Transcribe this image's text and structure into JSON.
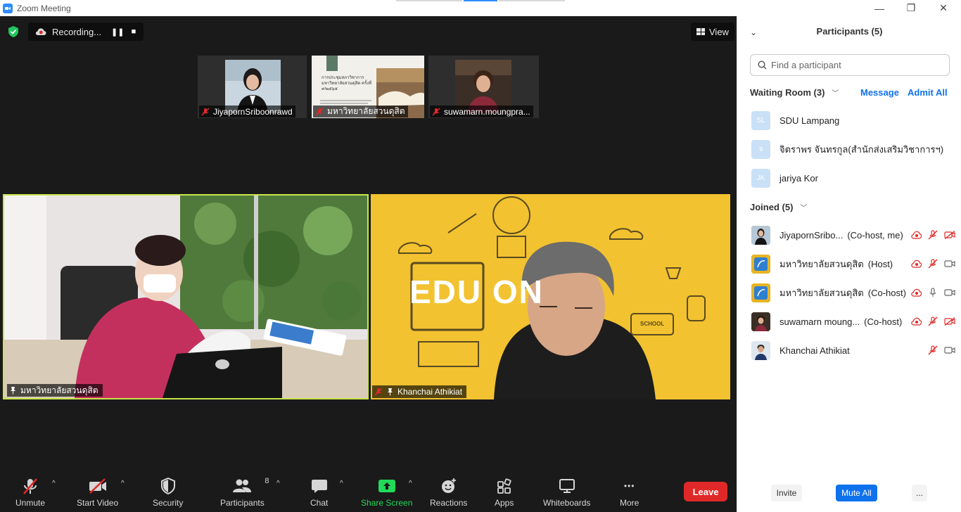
{
  "window": {
    "title": "Zoom Meeting",
    "minimize": "—",
    "restore": "❐",
    "close": "✕"
  },
  "topbar": {
    "recording_label": "Recording...",
    "pause_symbol": "❚❚",
    "stop_symbol": "■",
    "view_label": "View"
  },
  "thumbnails": [
    {
      "name": "JiyapornSriboonrawd"
    },
    {
      "name": "มหาวิทยาลัยสวนดุสิต",
      "slide_text": "การประชุมสภาวิชาการ มหาวิทยาลัยสวนดุสิต ครั้งที่ ๙/๒๕๖๕"
    },
    {
      "name": "suwamarn.moungpra..."
    }
  ],
  "tiles": [
    {
      "name": "มหาวิทยาลัยสวนดุสิต"
    },
    {
      "name": "Khanchai Athikiat",
      "background_text": "EDU ON",
      "school_text": "SCHOOL"
    }
  ],
  "toolbar": {
    "unmute": "Unmute",
    "start_video": "Start Video",
    "security": "Security",
    "participants": "Participants",
    "participants_count": "8",
    "chat": "Chat",
    "share_screen": "Share Screen",
    "reactions": "Reactions",
    "apps": "Apps",
    "whiteboards": "Whiteboards",
    "more": "More",
    "leave": "Leave",
    "more_dots": "•••",
    "caret": "^"
  },
  "panel": {
    "title": "Participants (5)",
    "collapse_symbol": "⌄",
    "search_placeholder": "Find a participant",
    "waiting_room": {
      "label": "Waiting Room (3)",
      "message": "Message",
      "admit_all": "Admit All",
      "people": [
        {
          "initials": "SL",
          "name": "SDU Lampang"
        },
        {
          "initials": "จ",
          "name": "จิตราพร จันทรกูล(สำนักส่งเสริมวิชาการฯ)"
        },
        {
          "initials": "JK",
          "name": "jariya Kor"
        }
      ]
    },
    "joined": {
      "label": "Joined (5)",
      "people": [
        {
          "name": "JiyapornSribo...",
          "role": "(Co-host, me)"
        },
        {
          "name": "มหาวิทยาลัยสวนดุสิต",
          "role": "(Host)"
        },
        {
          "name": "มหาวิทยาลัยสวนดุสิต",
          "role": "(Co-host)"
        },
        {
          "name": "suwamarn moung...",
          "role": "(Co-host)"
        },
        {
          "name": "Khanchai Athikiat",
          "role": ""
        }
      ]
    },
    "invite": "Invite",
    "mute_all": "Mute All",
    "more": "..."
  },
  "colors": {
    "accent": "#0e72ed",
    "zoom_blue": "#2d8cff",
    "leave_red": "#e02828",
    "share_green": "#23d959",
    "active_speaker_border": "#c8e64b",
    "edu_yellow": "#f2c230"
  }
}
